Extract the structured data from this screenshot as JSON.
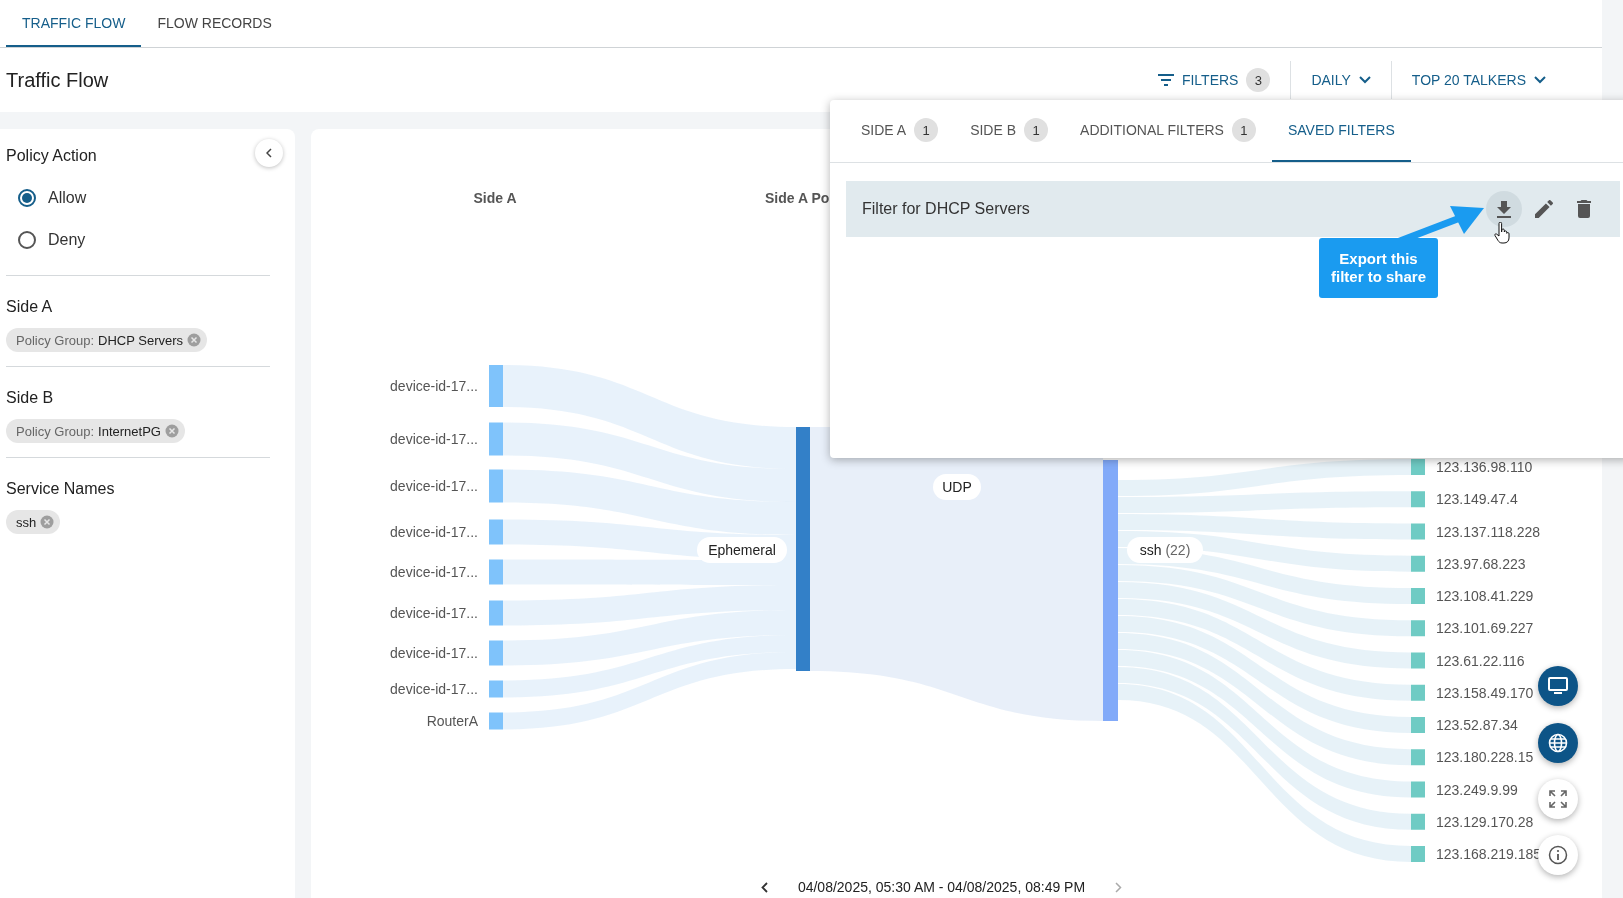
{
  "tabs": [
    {
      "label": "TRAFFIC FLOW",
      "selected": true
    },
    {
      "label": "FLOW RECORDS",
      "selected": false
    }
  ],
  "page_title": "Traffic Flow",
  "toolbar": {
    "filters": {
      "label": "FILTERS",
      "count": "3"
    },
    "period": "DAILY",
    "top": "TOP 20 TALKERS"
  },
  "sidebar": {
    "policy_action": {
      "title": "Policy Action",
      "options": [
        {
          "label": "Allow",
          "selected": true
        },
        {
          "label": "Deny",
          "selected": false
        }
      ]
    },
    "sections": [
      {
        "title": "Side A",
        "chips": [
          {
            "prefix": "Policy Group:",
            "value": "DHCP Servers"
          }
        ]
      },
      {
        "title": "Side B",
        "chips": [
          {
            "prefix": "Policy Group:",
            "value": "InternetPG"
          }
        ]
      },
      {
        "title": "Service Names",
        "chips": [
          {
            "value": "ssh"
          }
        ]
      }
    ]
  },
  "sankey": {
    "columns": [
      "Side A",
      "Side A Po"
    ],
    "side_a": [
      "device-id-17...",
      "device-id-17...",
      "device-id-17...",
      "device-id-17...",
      "device-id-17...",
      "device-id-17...",
      "device-id-17...",
      "device-id-17...",
      "RouterA"
    ],
    "port": "Ephemeral",
    "protocol": "UDP",
    "service": {
      "name": "ssh",
      "count": "(22)"
    },
    "destinations": [
      "123.136.98.110",
      "123.149.47.4",
      "123.137.118.228",
      "123.97.68.223",
      "123.108.41.229",
      "123.101.69.227",
      "123.61.22.116",
      "123.158.49.170",
      "123.52.87.34",
      "123.180.228.15",
      "123.249.9.99",
      "123.129.170.28",
      "123.168.219.185"
    ]
  },
  "date_range": "04/08/2025, 05:30 AM - 04/08/2025, 08:49 PM",
  "filter_panel": {
    "tabs": [
      {
        "label": "SIDE A",
        "count": "1",
        "selected": false
      },
      {
        "label": "SIDE B",
        "count": "1",
        "selected": false
      },
      {
        "label": "ADDITIONAL FILTERS",
        "count": "1",
        "selected": false
      },
      {
        "label": "SAVED FILTERS",
        "selected": true
      }
    ],
    "saved_filters": [
      {
        "name": "Filter for DHCP Servers"
      }
    ],
    "tooltip": "Export this filter to share"
  }
}
